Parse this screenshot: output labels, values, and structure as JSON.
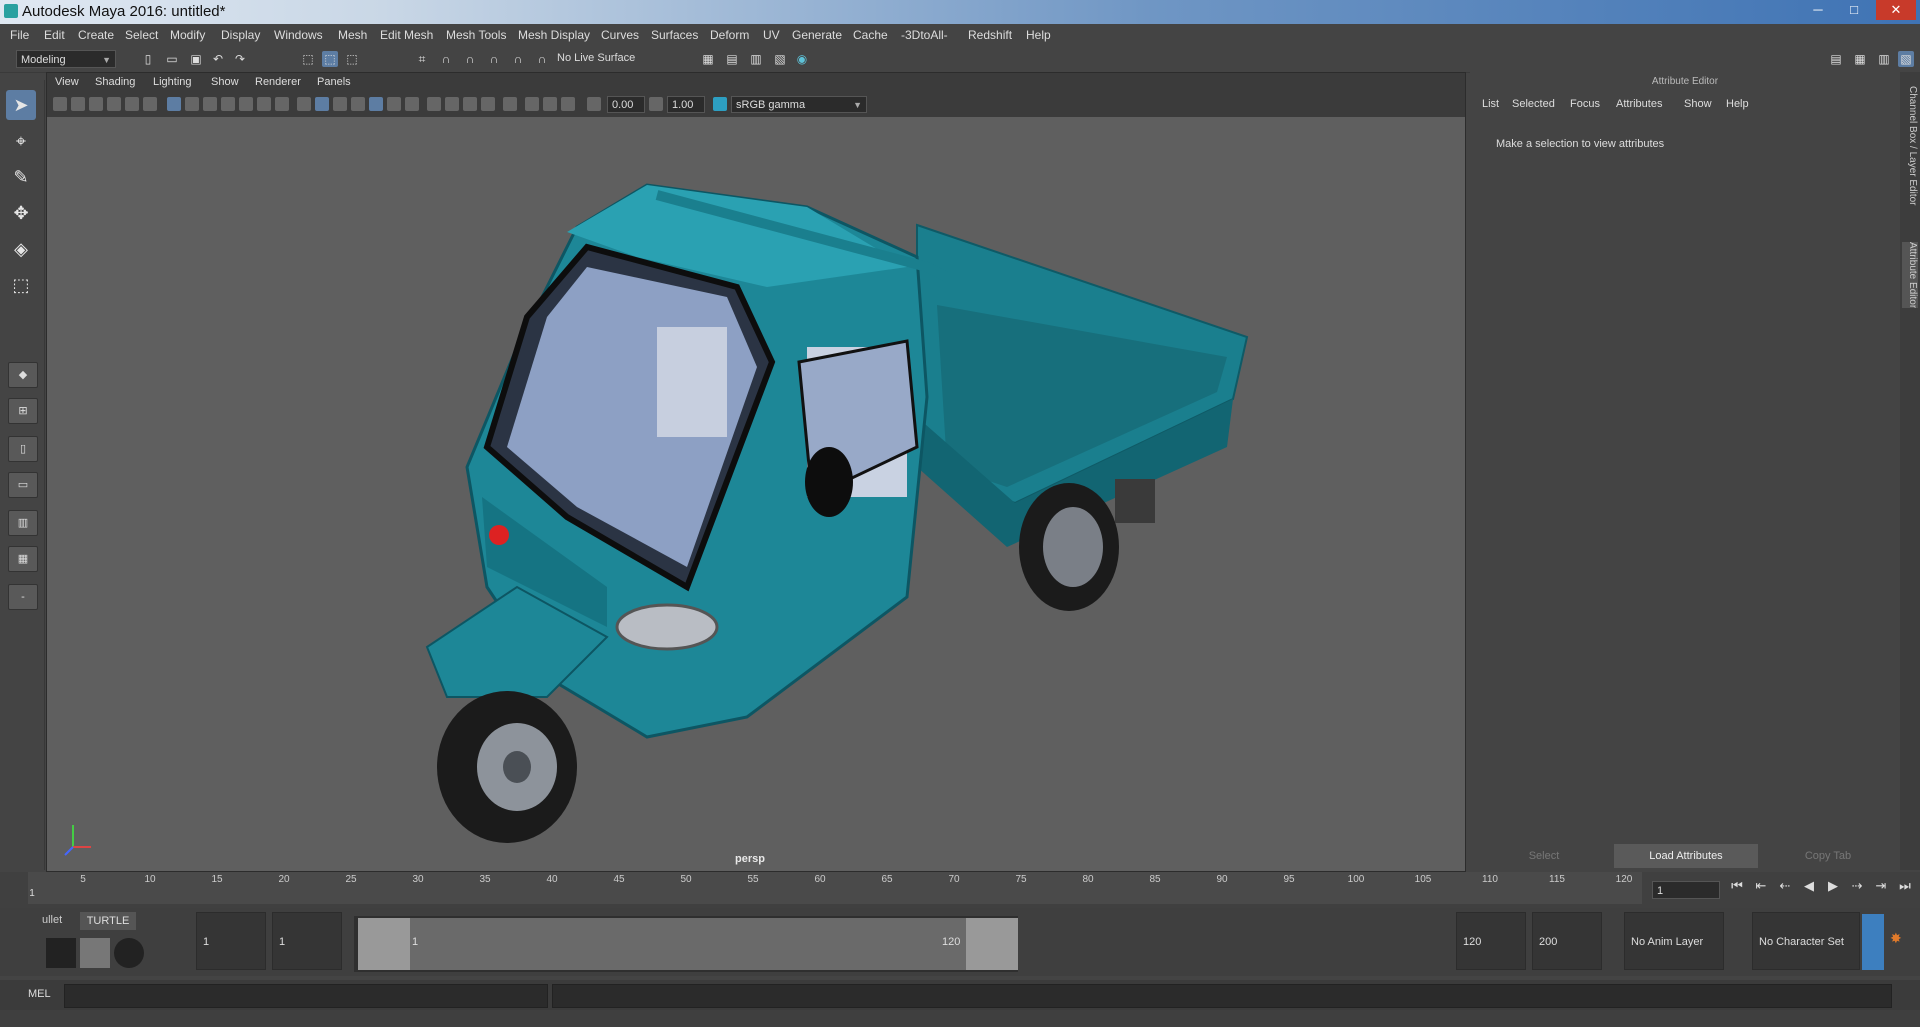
{
  "window": {
    "title": "Autodesk Maya 2016: untitled*",
    "minimize": "─",
    "maximize": "□",
    "close": "✕"
  },
  "menu": [
    "File",
    "Edit",
    "Create",
    "Select",
    "Modify",
    "Display",
    "Windows",
    "Mesh",
    "Edit Mesh",
    "Mesh Tools",
    "Mesh Display",
    "Curves",
    "Surfaces",
    "Deform",
    "UV",
    "Generate",
    "Cache",
    "-3DtoAll-",
    "Redshift",
    "Help"
  ],
  "toolbar": {
    "mode": "Modeling",
    "live_surface": "No Live Surface"
  },
  "panel": {
    "menu": [
      "View",
      "Shading",
      "Lighting",
      "Show",
      "Renderer",
      "Panels"
    ],
    "exposure": "0.00",
    "gamma": "1.00",
    "color_space": "sRGB gamma",
    "camera_label": "persp"
  },
  "attribute_editor": {
    "title": "Attribute Editor",
    "menu": [
      "List",
      "Selected",
      "Focus",
      "Attributes",
      "Show",
      "Help"
    ],
    "message": "Make a selection to view attributes",
    "buttons": {
      "select": "Select",
      "load": "Load Attributes",
      "copy": "Copy Tab"
    },
    "side_tabs": [
      "Channel Box / Layer Editor",
      "Attribute Editor"
    ]
  },
  "timeline": {
    "ticks": [
      "5",
      "10",
      "15",
      "20",
      "25",
      "30",
      "35",
      "40",
      "45",
      "50",
      "55",
      "60",
      "65",
      "70",
      "75",
      "80",
      "85",
      "90",
      "95",
      "100",
      "105",
      "110",
      "115",
      "120"
    ],
    "start_marker": "1",
    "current_frame": "1"
  },
  "range": {
    "start": "1",
    "start2": "1",
    "range_start_label": "1",
    "range_end_label": "120",
    "end": "120",
    "end2": "200",
    "anim_layer": "No Anim Layer",
    "character_set": "No Character Set"
  },
  "shelf": {
    "tab1": "ullet",
    "tab2": "TURTLE"
  },
  "command": {
    "label": "MEL"
  },
  "colors": {
    "accent": "#5d7da3",
    "truck": "#1d8797",
    "viewport_bg": "#5f5f5f"
  }
}
